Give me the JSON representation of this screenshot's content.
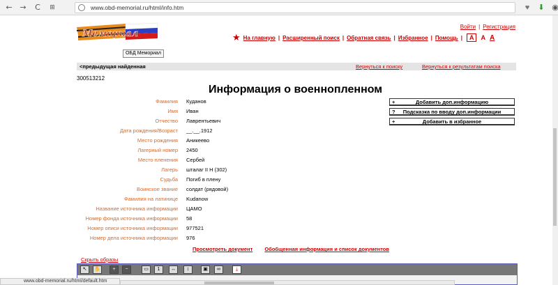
{
  "browser": {
    "url": "www.obd-memorial.ru/html/info.htm",
    "back": "←",
    "forward": "→",
    "reload": "C",
    "apps": "⊞"
  },
  "header": {
    "logo_text": "Мемориал",
    "logo_tooltip": "ОБД Мемориал",
    "login": "Войти",
    "register": "Регистрация",
    "nav": [
      "На главную",
      "Расширенный поиск",
      "Обратная связь",
      "Избранное",
      "Помощь"
    ],
    "font_sizes": [
      "A",
      "A",
      "A"
    ]
  },
  "navbar": {
    "prev": "<предыдущая найденная",
    "back_to_search": "Вернуться к поиску",
    "back_to_results": "Вернуться к результатам поиска"
  },
  "record": {
    "id": "300513212",
    "title": "Информация о военнопленном",
    "fields": [
      {
        "label": "Фамилия",
        "value": "Куданов"
      },
      {
        "label": "Имя",
        "value": "Иван"
      },
      {
        "label": "Отчество",
        "value": "Лаврентьевич"
      },
      {
        "label": "Дата рождения/Возраст",
        "value": "__.__.1912"
      },
      {
        "label": "Место рождения",
        "value": "Аникеево"
      },
      {
        "label": "Лагерный номер",
        "value": "2450"
      },
      {
        "label": "Место пленения",
        "value": "Сербей"
      },
      {
        "label": "Лагерь",
        "value": "шталаг II H (302)"
      },
      {
        "label": "Судьба",
        "value": "Погиб в плену"
      },
      {
        "label": "Воинское звание",
        "value": "солдат (рядовой)"
      },
      {
        "label": "Фамилия на латинице",
        "value": "Kudanow"
      },
      {
        "label": "Название источника информации",
        "value": "ЦАМО"
      },
      {
        "label": "Номер фонда источника информации",
        "value": "58"
      },
      {
        "label": "Номер описи источника информации",
        "value": "977521"
      },
      {
        "label": "Номер дела источника информации",
        "value": "976"
      }
    ]
  },
  "actions": [
    {
      "prefix": "+",
      "label": "Добавить доп.информацию"
    },
    {
      "prefix": "?",
      "label": "Подсказка по вводу доп.информации"
    },
    {
      "prefix": "+",
      "label": "Добавить в избранное"
    }
  ],
  "documents": {
    "view": "Просмотреть документ",
    "summary": "Обобщенная информация и список документов",
    "hide_images": "Скрыть образы"
  },
  "status_url": "www.obd-memorial.ru/html/default.htm",
  "colors": {
    "accent": "#cc0000",
    "label": "#d86a2a"
  }
}
